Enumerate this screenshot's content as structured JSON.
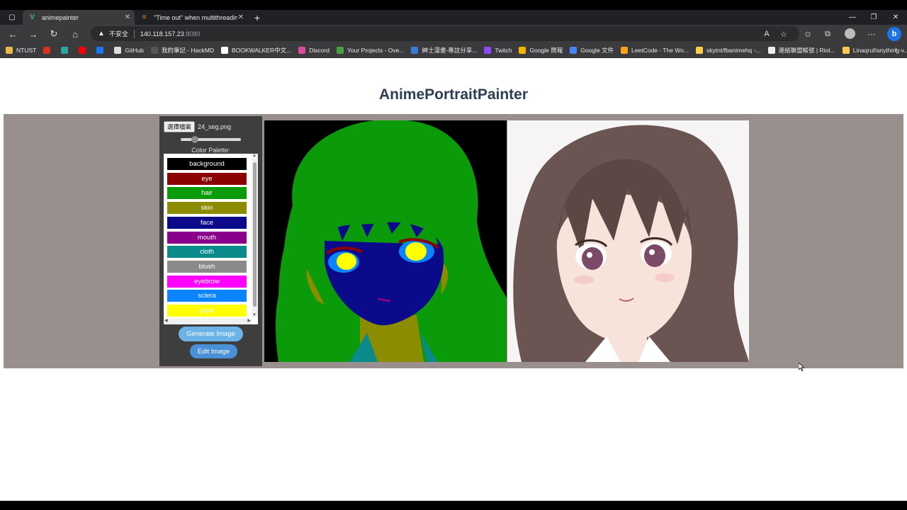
{
  "browser": {
    "tabs": [
      {
        "title": "animepainter",
        "active": true
      },
      {
        "title": "\"Time out\" when multithreading",
        "active": false
      }
    ],
    "address": {
      "security_label": "不安全",
      "host": "140.118.157.23",
      "port": ":8080"
    },
    "bookmarks": [
      {
        "label": "NTUST",
        "icon": "folder-icon",
        "color": "#e8b84a"
      },
      {
        "label": "",
        "icon": "gmail-icon",
        "color": "#d93025"
      },
      {
        "label": "",
        "icon": "app-icon",
        "color": "#2aa5a0"
      },
      {
        "label": "",
        "icon": "youtube-icon",
        "color": "#ff0000"
      },
      {
        "label": "",
        "icon": "facebook-icon",
        "color": "#1877f2"
      },
      {
        "label": "GitHub",
        "icon": "github-icon",
        "color": "#dddddd"
      },
      {
        "label": "我的筆記 - HackMD",
        "icon": "hackmd-icon",
        "color": "#555555"
      },
      {
        "label": "BOOKWALKER中文...",
        "icon": "bookwalker-icon",
        "color": "#ffffff"
      },
      {
        "label": "Discord",
        "icon": "discord-icon",
        "color": "#d94b9f"
      },
      {
        "label": "Your Projects - Ove...",
        "icon": "overleaf-icon",
        "color": "#47a141"
      },
      {
        "label": "紳士漫畫-專註分享...",
        "icon": "site-icon",
        "color": "#3a7bd5"
      },
      {
        "label": "Twitch",
        "icon": "twitch-icon",
        "color": "#9146ff"
      },
      {
        "label": "Google 簡報",
        "icon": "slides-icon",
        "color": "#f4b400"
      },
      {
        "label": "Google 文件",
        "icon": "docs-icon",
        "color": "#4285f4"
      },
      {
        "label": "LeetCode - The Wo...",
        "icon": "leetcode-icon",
        "color": "#ffa116"
      },
      {
        "label": "skytnt/fbanimehq -...",
        "icon": "huggingface-icon",
        "color": "#ffcc4d"
      },
      {
        "label": "連結聯盟帳號 | Riot...",
        "icon": "riot-icon",
        "color": "#eeeeee"
      },
      {
        "label": "Linaqruf/anything-v...",
        "icon": "huggingface-icon",
        "color": "#ffcc4d"
      }
    ]
  },
  "app": {
    "title": "AnimePortraitPainter",
    "file_button": "選擇檔案",
    "file_name": "24_seg.png",
    "brush_size": 0.2,
    "palette_title": "Color Palette:",
    "palette": [
      {
        "label": "background",
        "color": "#000000"
      },
      {
        "label": "eye",
        "color": "#8b0000"
      },
      {
        "label": "hair",
        "color": "#0a9a0a"
      },
      {
        "label": "skin",
        "color": "#8c8c00"
      },
      {
        "label": "face",
        "color": "#0a0a8a"
      },
      {
        "label": "mouth",
        "color": "#8a008a"
      },
      {
        "label": "cloth",
        "color": "#0a8a8a"
      },
      {
        "label": "blush",
        "color": "#8a8a8a"
      },
      {
        "label": "eyebrow",
        "color": "#ff00ff"
      },
      {
        "label": "sclera",
        "color": "#0a84ff"
      },
      {
        "label": "pupil",
        "color": "#ffff00"
      }
    ],
    "generate_button": "Generate Image",
    "edit_button": "Edit Image"
  }
}
